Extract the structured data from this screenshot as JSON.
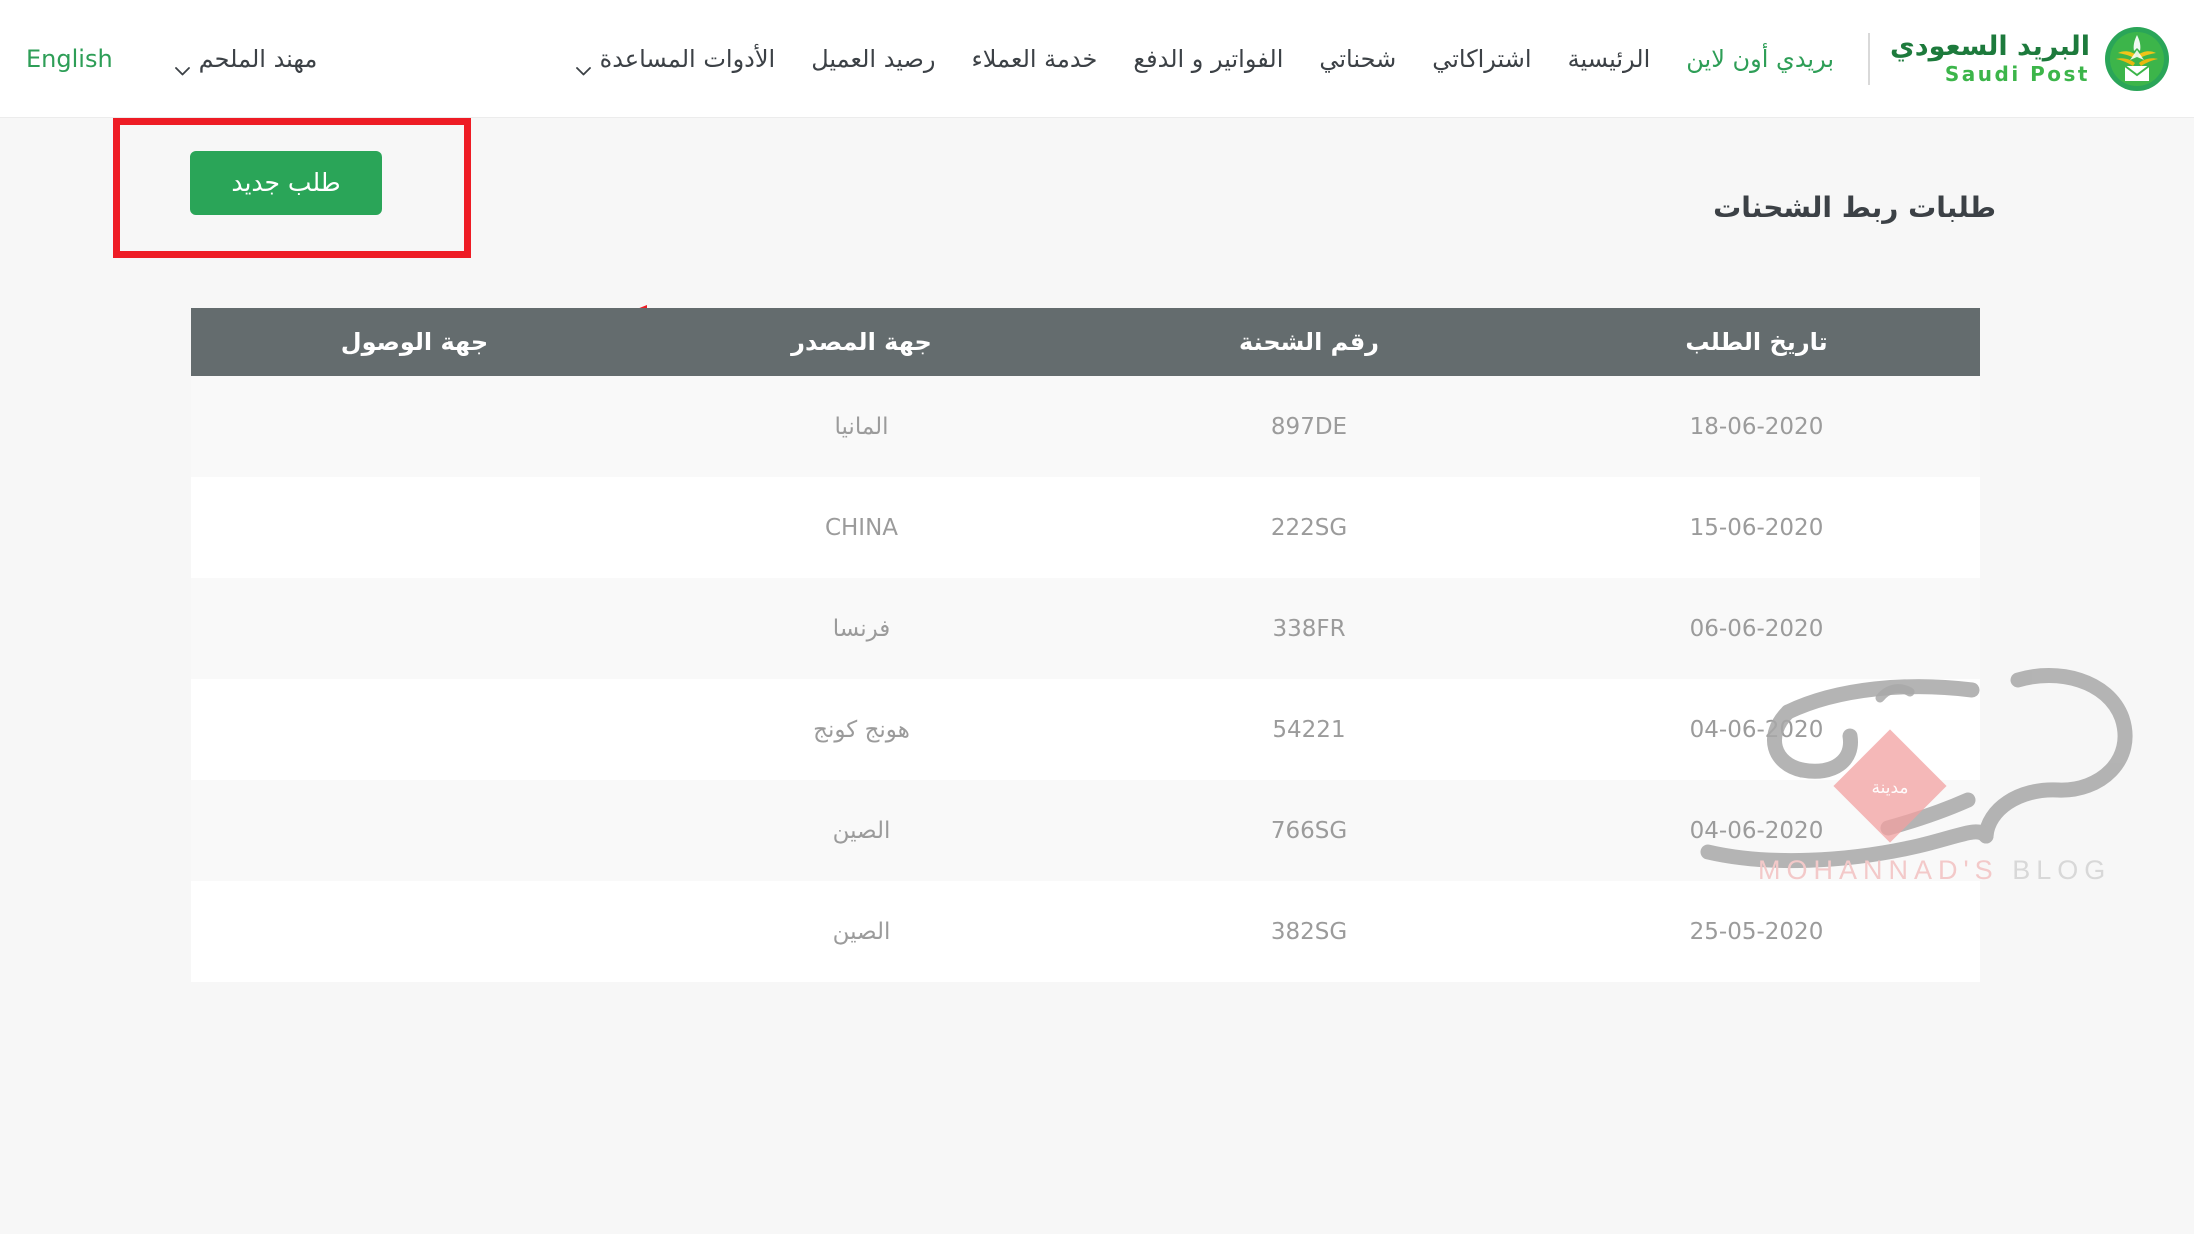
{
  "header": {
    "brand": {
      "arabic": "البريد السعودي",
      "english": "Saudi Post",
      "emblem_icon": "saudi-post-emblem-icon",
      "green_dark": "#1d7a3c",
      "green_light": "#3cb54a"
    },
    "nav_items": [
      {
        "label": "بريدي أون لاين",
        "accent": true,
        "caret": false
      },
      {
        "label": "الرئيسية",
        "accent": false,
        "caret": false
      },
      {
        "label": "اشتراكاتي",
        "accent": false,
        "caret": false
      },
      {
        "label": "شحناتي",
        "accent": false,
        "caret": false
      },
      {
        "label": "الفواتير و الدفع",
        "accent": false,
        "caret": false
      },
      {
        "label": "خدمة العملاء",
        "accent": false,
        "caret": false
      },
      {
        "label": "رصيد العميل",
        "accent": false,
        "caret": false
      },
      {
        "label": "الأدوات المساعدة",
        "accent": false,
        "caret": true
      }
    ],
    "user_menu": {
      "label": "مهند الملحم",
      "caret_icon": "chevron-down-icon"
    },
    "language_toggle": {
      "label": "English"
    }
  },
  "main": {
    "page_title": "طلبات ربط الشحنات",
    "new_request_button": "طلب جديد",
    "table": {
      "columns": [
        "تاريخ الطلب",
        "رقم الشحنة",
        "جهة المصدر",
        "جهة الوصول"
      ],
      "rows": [
        {
          "date": "18-06-2020",
          "shipment": "897DE",
          "source": "المانيا",
          "destination": ""
        },
        {
          "date": "15-06-2020",
          "shipment": "222SG",
          "source": "CHINA",
          "destination": ""
        },
        {
          "date": "06-06-2020",
          "shipment": "338FR",
          "source": "فرنسا",
          "destination": ""
        },
        {
          "date": "04-06-2020",
          "shipment": "54221",
          "source": "هونج كونج",
          "destination": ""
        },
        {
          "date": "04-06-2020",
          "shipment": "766SG",
          "source": "الصين",
          "destination": ""
        },
        {
          "date": "25-05-2020",
          "shipment": "382SG",
          "source": "الصين",
          "destination": ""
        }
      ]
    }
  },
  "annotations": {
    "highlight_box_color": "#ee1c25",
    "arrow_color": "#ee1c25",
    "arrow_direction": "left"
  },
  "watermark": {
    "calligraphy": "مهند",
    "badge_text": "مدينة",
    "blog_text_accent": "MOHANNAD'S",
    "blog_text_plain": "BLOG",
    "accent_color": "#f3c9c9"
  },
  "theme": {
    "brand_green": "#2aa558",
    "table_header_gray": "#646c6e",
    "page_background": "#f7f7f7",
    "row_alt_background": "#f9f9f9",
    "text_gray": "#9b9b9b"
  }
}
